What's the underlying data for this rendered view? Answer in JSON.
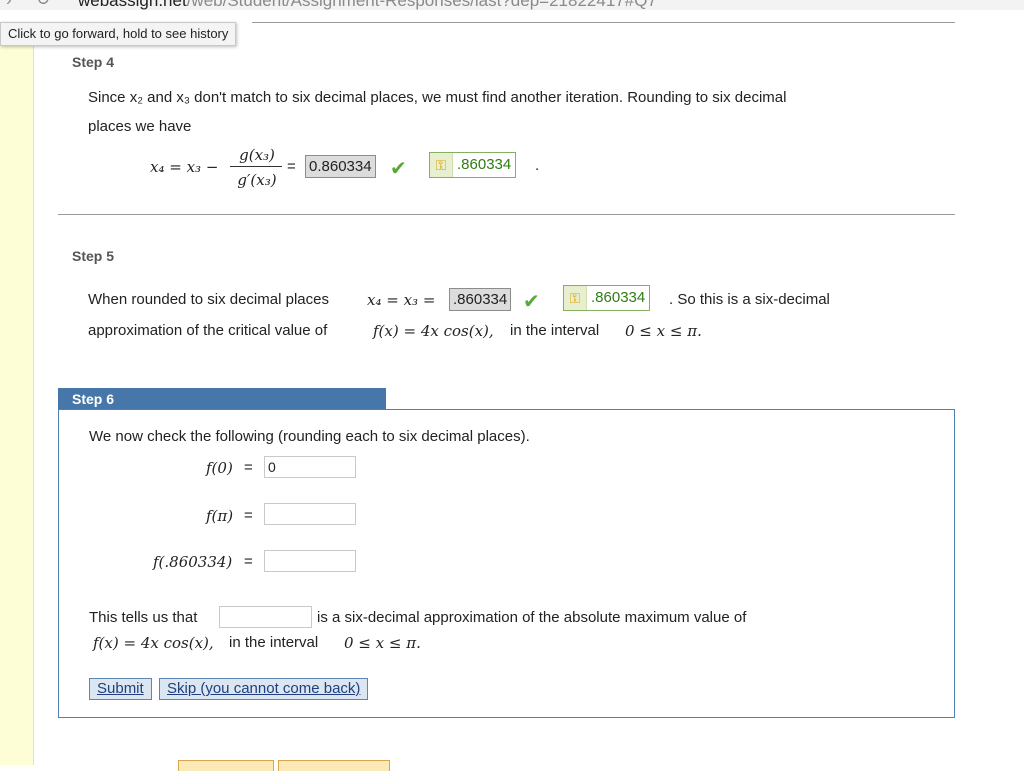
{
  "browser": {
    "url_host": "webassign.net",
    "url_path": "/web/Student/Assignment-Responses/last?dep=21822417#Q7",
    "tooltip": "Click to go forward, hold to see history"
  },
  "step4": {
    "label": "Step 4",
    "text_line1": "Since x₂ and x₃ don't match to six decimal places, we must find another iteration. Rounding to six decimal",
    "text_line2": "places we have",
    "formula_lhs": "x₄ = x₃ −",
    "frac_num": "g(x₃)",
    "frac_den": "g′(x₃)",
    "equals": "=",
    "answer": "0.860334",
    "key": ".860334",
    "period": "."
  },
  "step5": {
    "label": "Step 5",
    "text_a": "When rounded to six decimal places",
    "formula": "x₄ = x₃ =",
    "answer": ".860334",
    "key": ".860334",
    "text_b": ". So this is a six-decimal",
    "text_c": "approximation of the critical value of",
    "func": "f(x) = 4x cos(x),",
    "text_d": "in the interval",
    "interval": "0 ≤ x ≤ π."
  },
  "step6": {
    "label": "Step 6",
    "intro": "We now check the following (rounding each to six decimal places).",
    "rows": [
      {
        "label": "f(0)",
        "eq": "=",
        "value": "0"
      },
      {
        "label": "f(π)",
        "eq": "=",
        "value": ""
      },
      {
        "label": "f(.860334)",
        "eq": "=",
        "value": ""
      }
    ],
    "tells_a": "This tells us that",
    "tells_value": "",
    "tells_b": "is a six-decimal approximation of the absolute maximum value of",
    "func": "f(x) = 4x cos(x),",
    "text_d": "in the interval",
    "interval": "0 ≤ x ≤ π.",
    "submit": "Submit",
    "skip": "Skip (you cannot come back)"
  }
}
